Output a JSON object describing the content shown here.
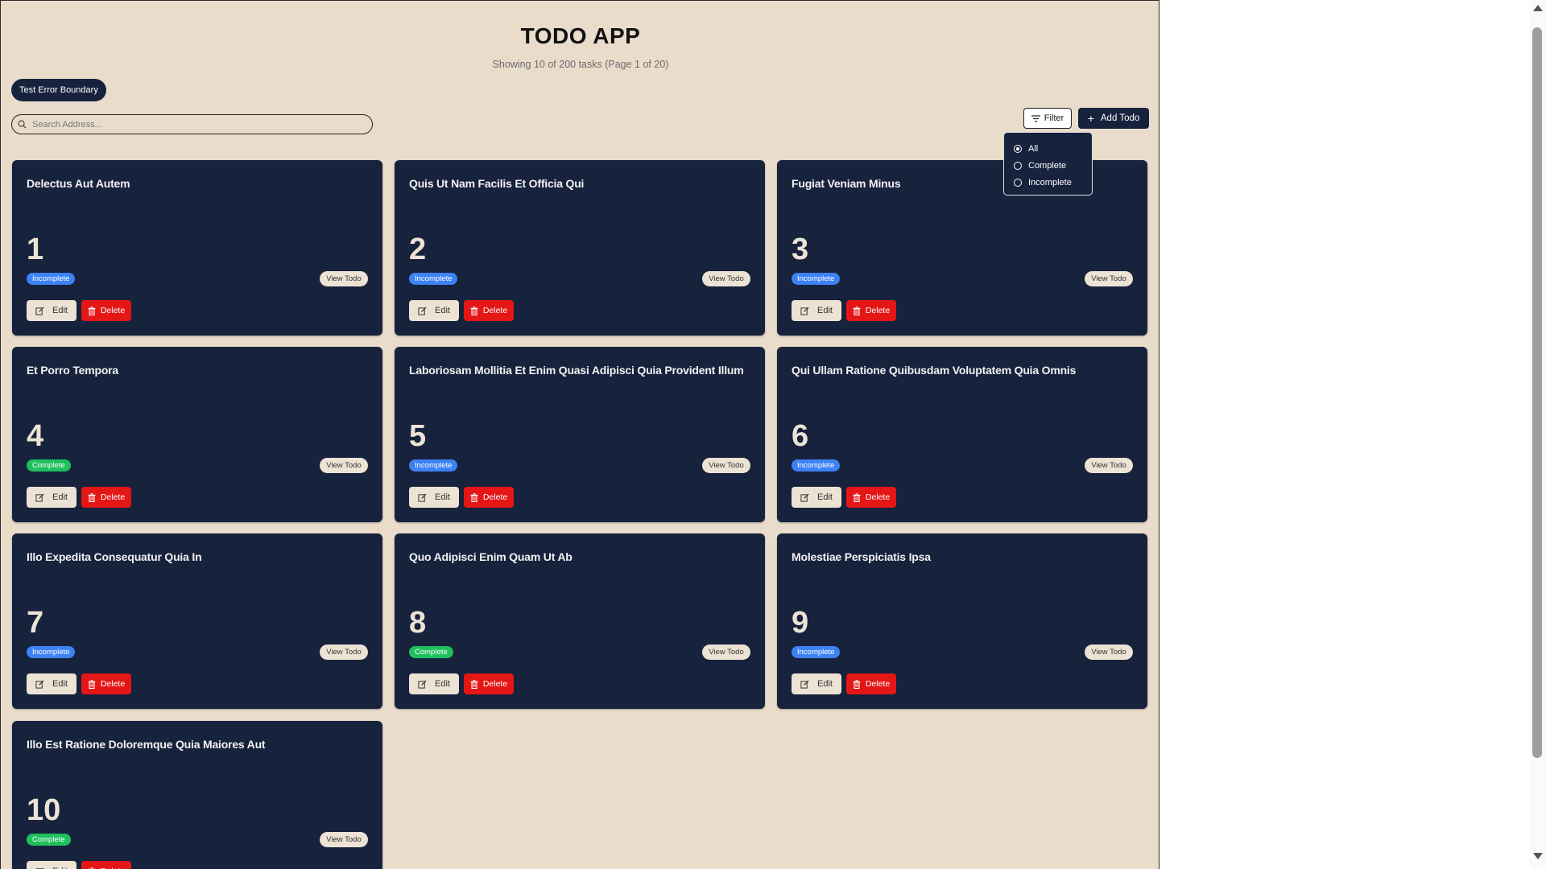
{
  "header": {
    "title": "TODO APP",
    "subtitle": "Showing 10 of 200 tasks (Page 1 of 20)"
  },
  "error_button": "Test Error Boundary",
  "search": {
    "placeholder": "Search Address...",
    "value": ""
  },
  "toolbar": {
    "filter_label": "Filter",
    "add_label": "Add Todo"
  },
  "filter_menu": {
    "selected": "All",
    "options": [
      "All",
      "Complete",
      "Incomplete"
    ]
  },
  "card_labels": {
    "view": "View Todo",
    "edit": "Edit",
    "delete": "Delete"
  },
  "colors": {
    "background": "#e9dccb",
    "card": "#17223d",
    "incomplete": "#3d82f5",
    "complete": "#1fc05e",
    "delete": "#e41616"
  },
  "todos": [
    {
      "title": "Delectus Aut Autem",
      "number": "1",
      "status": "Incomplete"
    },
    {
      "title": "Quis Ut Nam Facilis Et Officia Qui",
      "number": "2",
      "status": "Incomplete"
    },
    {
      "title": "Fugiat Veniam Minus",
      "number": "3",
      "status": "Incomplete"
    },
    {
      "title": "Et Porro Tempora",
      "number": "4",
      "status": "Complete"
    },
    {
      "title": "Laboriosam Mollitia Et Enim Quasi Adipisci Quia Provident Illum",
      "number": "5",
      "status": "Incomplete"
    },
    {
      "title": "Qui Ullam Ratione Quibusdam Voluptatem Quia Omnis",
      "number": "6",
      "status": "Incomplete"
    },
    {
      "title": "Illo Expedita Consequatur Quia In",
      "number": "7",
      "status": "Incomplete"
    },
    {
      "title": "Quo Adipisci Enim Quam Ut Ab",
      "number": "8",
      "status": "Complete"
    },
    {
      "title": "Molestiae Perspiciatis Ipsa",
      "number": "9",
      "status": "Incomplete"
    },
    {
      "title": "Illo Est Ratione Doloremque Quia Maiores Aut",
      "number": "10",
      "status": "Complete"
    }
  ]
}
